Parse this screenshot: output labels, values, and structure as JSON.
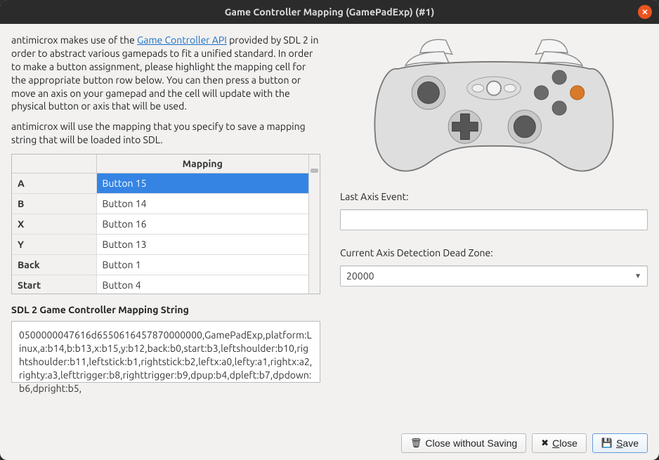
{
  "window": {
    "title": "Game Controller Mapping (GamePadExp) (#1)"
  },
  "description": {
    "part1": "antimicrox makes use of the ",
    "link_text": "Game Controller API",
    "part2": " provided by SDL 2 in order to abstract various gamepads to fit a unified standard. In order to make a button assignment, please highlight the mapping cell for the appropriate button row below. You can then press a button or move an axis on your gamepad and the cell will update with the physical button or axis that will be used.",
    "para2": "antimicrox will use the mapping that you specify to save a mapping string that will be loaded into SDL."
  },
  "table": {
    "header_blank": "",
    "header_mapping": "Mapping",
    "rows": [
      {
        "label": "A",
        "mapping": "Button 15",
        "selected": true
      },
      {
        "label": "B",
        "mapping": "Button 14",
        "selected": false
      },
      {
        "label": "X",
        "mapping": "Button 16",
        "selected": false
      },
      {
        "label": "Y",
        "mapping": "Button 13",
        "selected": false
      },
      {
        "label": "Back",
        "mapping": "Button 1",
        "selected": false
      },
      {
        "label": "Start",
        "mapping": "Button 4",
        "selected": false
      }
    ]
  },
  "mapping_string_label": "SDL 2 Game Controller Mapping String",
  "mapping_string": "0500000047616d6550616457870000000,GamePadExp,platform:Linux,a:b14,b:b13,x:b15,y:b12,back:b0,start:b3,leftshoulder:b10,rightshoulder:b11,leftstick:b1,rightstick:b2,leftx:a0,lefty:a1,rightx:a2,righty:a3,lefttrigger:b8,righttrigger:b9,dpup:b4,dpleft:b7,dpdown:b6,dpright:b5,",
  "right": {
    "last_axis_label": "Last Axis Event:",
    "last_axis_value": "",
    "deadzone_label": "Current Axis Detection Dead Zone:",
    "deadzone_value": "20000"
  },
  "buttons": {
    "close_no_save": "Close without Saving",
    "close": "Close",
    "save_prefix": "S",
    "save_rest": "ave"
  }
}
